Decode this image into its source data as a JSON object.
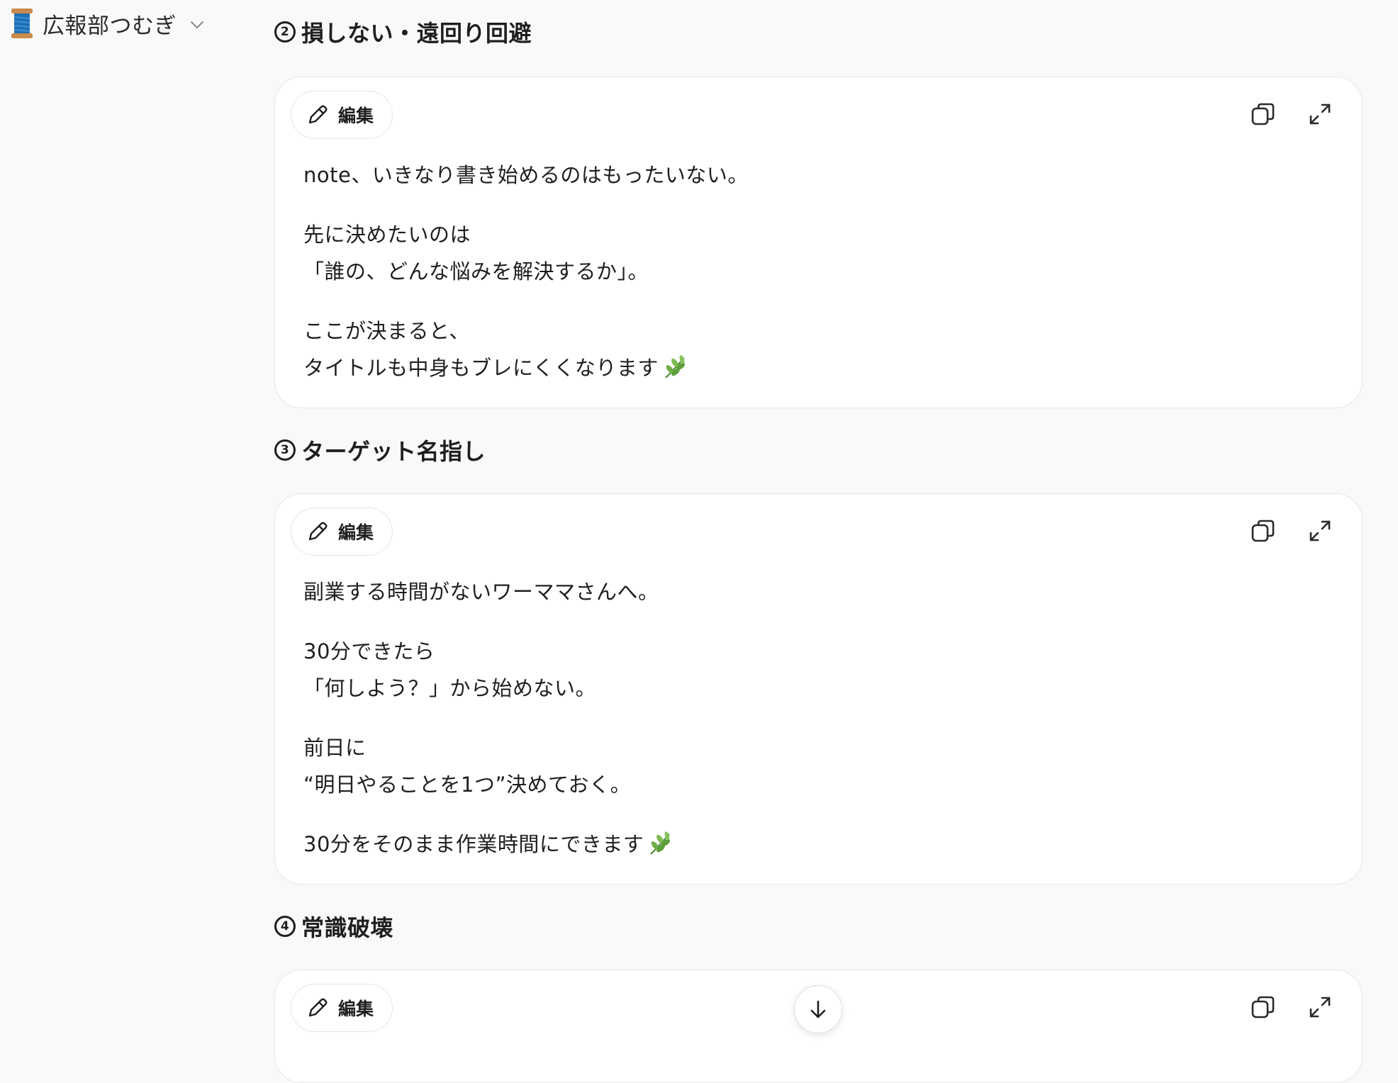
{
  "header": {
    "gpt_name": "広報部つむぎ",
    "avatar_icon": "thread-spool-icon",
    "dropdown_icon": "chevron-down-icon"
  },
  "colors": {
    "background": "#f9f9f9",
    "card_background": "#ffffff",
    "text": "#1f1f1f",
    "border": "#e6e6e6"
  },
  "sections": [
    {
      "number": "2",
      "title": "損しない・遠回り回避",
      "edit_label": "編集",
      "paragraphs": [
        [
          "note、いきなり書き始めるのはもったいない。"
        ],
        [
          "先に決めたいのは",
          "「誰の、どんな悩みを解決するか」。"
        ],
        [
          "ここが決まると、",
          "タイトルも中身もブレにくくなります"
        ]
      ]
    },
    {
      "number": "3",
      "title": "ターゲット名指し",
      "edit_label": "編集",
      "paragraphs": [
        [
          "副業する時間がないワーママさんへ。"
        ],
        [
          "30分できたら",
          "「何しよう？」から始めない。"
        ],
        [
          "前日に",
          "“明日やることを1つ”決めておく。"
        ],
        [
          "30分をそのまま作業時間にできます"
        ]
      ]
    },
    {
      "number": "4",
      "title": "常識破壊",
      "edit_label": "編集",
      "paragraphs": []
    }
  ],
  "controls": {
    "copy_icon": "copy-icon",
    "expand_icon": "expand-icon",
    "scroll_icon": "arrow-down-icon"
  }
}
